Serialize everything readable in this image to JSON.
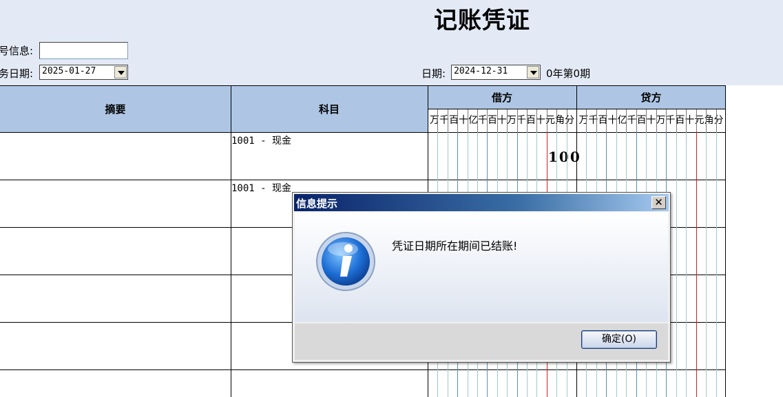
{
  "voucher": {
    "title": "记账凭证",
    "info_label": "号信息:",
    "biz_date_label": "务日期:",
    "biz_date_value": "2025-01-27",
    "date_label": "日期:",
    "date_value": "2024-12-31",
    "period_text": "0年第0期"
  },
  "table": {
    "headers": {
      "summary": "摘要",
      "subject": "科目",
      "debit": "借方",
      "credit": "贷方"
    },
    "digit_units": "万千百十亿千百十万千百十元角分",
    "rows": [
      {
        "subject": "1001 - 现金",
        "debit_amount": "100"
      },
      {
        "subject": "1001 - 现金",
        "debit_amount": ""
      },
      {
        "subject": "",
        "debit_amount": ""
      },
      {
        "subject": "",
        "debit_amount": ""
      },
      {
        "subject": "",
        "debit_amount": ""
      },
      {
        "subject": "",
        "debit_amount": ""
      }
    ]
  },
  "dialog": {
    "title": "信息提示",
    "close_glyph": "✕",
    "message": "凭证日期所在期间已结账!",
    "ok_label": "确定(O)",
    "icon": "info-icon"
  }
}
